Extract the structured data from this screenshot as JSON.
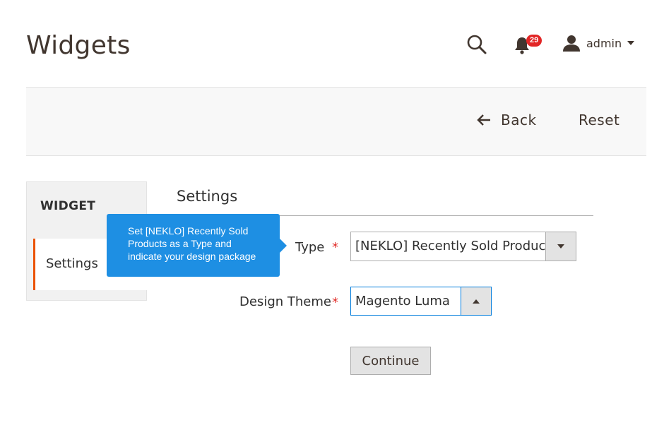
{
  "header": {
    "title": "Widgets",
    "notifications_count": "29",
    "user_name": "admin",
    "icons": [
      "search-icon",
      "bell-icon",
      "user-icon",
      "caret-down-icon"
    ]
  },
  "toolbar": {
    "back_label": "Back",
    "reset_label": "Reset"
  },
  "sidebar": {
    "title": "WIDGET",
    "tabs": [
      {
        "label": "Settings",
        "active": true
      }
    ]
  },
  "main": {
    "section_title": "Settings",
    "tooltip": "Set [NEKLO] Recently Sold Products as a Type and indicate your design package",
    "fields": [
      {
        "label": "Type",
        "required": true,
        "value": "[NEKLO] Recently Sold Products"
      },
      {
        "label": "Design Theme",
        "required": true,
        "value": "Magento Luma"
      }
    ],
    "continue_label": "Continue"
  },
  "colors": {
    "accent": "#eb5202",
    "tooltip": "#1e8fe3",
    "badge": "#e22626",
    "focus_border": "#007bdb"
  }
}
